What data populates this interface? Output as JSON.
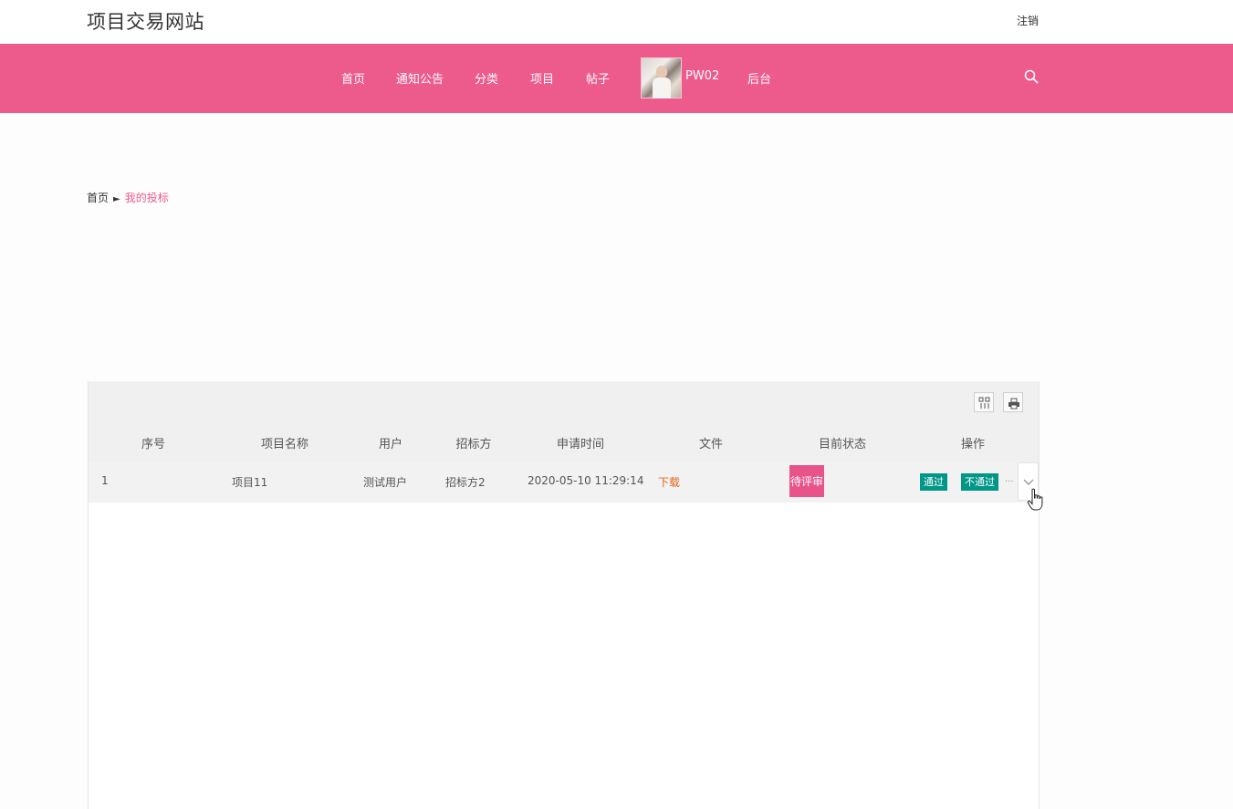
{
  "header": {
    "site_title": "项目交易网站",
    "logout_label": "注销"
  },
  "nav": {
    "items": [
      {
        "label": "首页"
      },
      {
        "label": "通知公告"
      },
      {
        "label": "分类"
      },
      {
        "label": "项目"
      },
      {
        "label": "帖子"
      }
    ],
    "username": "PW02",
    "admin_label": "后台",
    "search_icon": "search-icon",
    "accent_color": "#ed5a8c"
  },
  "breadcrumb": {
    "home": "首页",
    "separator": "►",
    "current": "我的投标"
  },
  "table": {
    "toolbar_icons": [
      "columns-icon",
      "print-icon"
    ],
    "columns": [
      "序号",
      "项目名称",
      "用户",
      "招标方",
      "申请时间",
      "文件",
      "目前状态",
      "操作"
    ],
    "rows": [
      {
        "index": "1",
        "project_name": "项目11",
        "user": "测试用户",
        "tenderer": "招标方2",
        "apply_time": "2020-05-10 11:29:14",
        "file_link": "下载",
        "status": "待评审",
        "actions": [
          "通过",
          "不通过"
        ],
        "more": "..."
      }
    ],
    "status_color": "#e8548a",
    "action_color": "#009688"
  }
}
